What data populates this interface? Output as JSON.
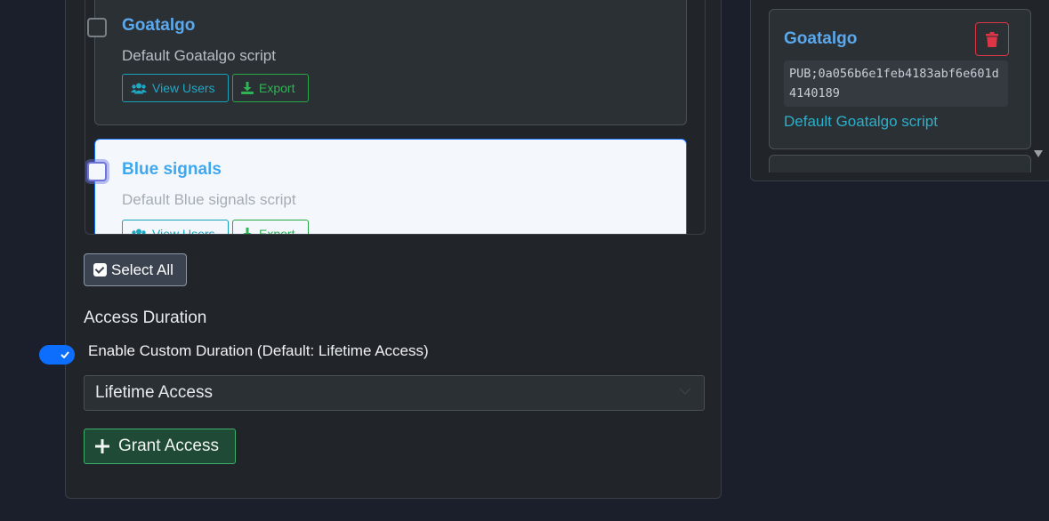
{
  "scripts": [
    {
      "title": "Goatalgo",
      "description": "Default Goatalgo script",
      "view_users_label": "View Users",
      "export_label": "Export",
      "selected": false
    },
    {
      "title": "Blue signals",
      "description": "Default Blue signals script",
      "view_users_label": "View Users",
      "export_label": "Export",
      "selected": false
    }
  ],
  "select_all_label": "Select All",
  "access_duration": {
    "heading": "Access Duration",
    "toggle_label": "Enable Custom Duration (Default: Lifetime Access)",
    "toggle_on": true,
    "selected_option": "Lifetime Access"
  },
  "grant_access_label": "Grant Access",
  "right_panel": {
    "card": {
      "title": "Goatalgo",
      "key": "PUB;0a056b6e1feb4183abf6e601d4140189",
      "description": "Default Goatalgo script"
    }
  },
  "colors": {
    "accent_blue": "#0d6efd",
    "info": "#17a2b8",
    "success": "#28a745",
    "danger": "#dc3545",
    "title_blue": "#5aa8ee"
  },
  "icons": {
    "view_users": "users-icon",
    "export": "download-icon",
    "select_all": "checkbox-checked-icon",
    "grant": "plus-icon",
    "delete": "trash-icon",
    "select": "chevron-down-icon"
  }
}
